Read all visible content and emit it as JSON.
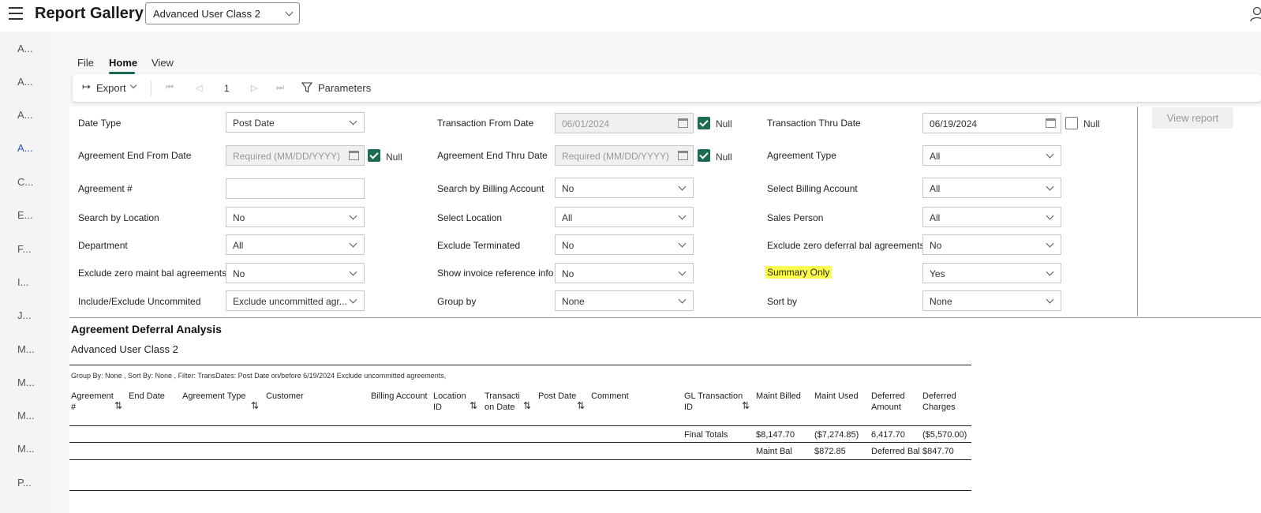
{
  "header": {
    "title": "Report Gallery",
    "class_select": "Advanced User Class 2"
  },
  "sidebar": {
    "items": [
      "A...",
      "A...",
      "A...",
      "A...",
      "C...",
      "E...",
      "F...",
      "I...",
      "J...",
      "M...",
      "M...",
      "M...",
      "M...",
      "P..."
    ],
    "active_index": 3
  },
  "tabs": [
    "File",
    "Home",
    "View"
  ],
  "toolbar": {
    "export_label": "Export",
    "page_number": "1",
    "parameters_label": "Parameters"
  },
  "params": {
    "date_type_label": "Date Type",
    "date_type_value": "Post Date",
    "trans_from_label": "Transaction From Date",
    "trans_from_value": "06/01/2024",
    "trans_thru_label": "Transaction Thru Date",
    "trans_thru_value": "06/19/2024",
    "agr_end_from_label": "Agreement End From Date",
    "agr_end_from_placeholder": "Required (MM/DD/YYYY)",
    "agr_end_thru_label": "Agreement End Thru Date",
    "agr_end_thru_placeholder": "Required (MM/DD/YYYY)",
    "agr_type_label": "Agreement Type",
    "agr_type_value": "All",
    "agr_num_label": "Agreement #",
    "agr_num_value": "",
    "search_billing_label": "Search by Billing Account",
    "search_billing_value": "No",
    "select_billing_label": "Select Billing Account",
    "select_billing_value": "All",
    "search_loc_label": "Search by Location",
    "search_loc_value": "No",
    "select_loc_label": "Select Location",
    "select_loc_value": "All",
    "sales_person_label": "Sales Person",
    "sales_person_value": "All",
    "department_label": "Department",
    "department_value": "All",
    "excl_term_label": "Exclude Terminated",
    "excl_term_value": "No",
    "excl_zero_def_label": "Exclude zero deferral bal agreements",
    "excl_zero_def_value": "No",
    "excl_zero_maint_label": "Exclude zero maint bal agreements",
    "excl_zero_maint_value": "No",
    "show_invoice_label": "Show invoice reference info",
    "show_invoice_value": "No",
    "summary_only_label": "Summary Only",
    "summary_only_value": "Yes",
    "incl_excl_label": "Include/Exclude Uncommited",
    "incl_excl_value": "Exclude uncommitted agr...",
    "group_by_label": "Group by",
    "group_by_value": "None",
    "sort_by_label": "Sort by",
    "sort_by_value": "None",
    "null_label": "Null",
    "view_report_label": "View report"
  },
  "report": {
    "title": "Agreement Deferral Analysis",
    "subtitle": "Advanced User Class 2",
    "filter_text": "Group By: None , Sort By: None , Filter: TransDates: Post Date on/before 6/19/2024 Exclude uncommitted agreements,",
    "columns": {
      "agreement": "Agreement #",
      "end_date": "End Date",
      "agreement_type": "Agreement Type",
      "customer": "Customer",
      "billing_account": "Billing Account",
      "location_id": "Location ID",
      "transaction_date": "Transacti on Date",
      "post_date": "Post Date",
      "comment": "Comment",
      "gl_transaction_id": "GL Transaction ID",
      "maint_billed": "Maint Billed",
      "maint_used": "Maint Used",
      "deferred_amount": "Deferred Amount",
      "deferred_charges": "Deferred Charges"
    },
    "totals": {
      "label": "Final Totals",
      "maint_billed": "$8,147.70",
      "maint_used": "($7,274.85)",
      "deferred_amount": "6,417.70",
      "deferred_charges": "($5,570.00)"
    },
    "balances": {
      "maint_bal_label": "Maint Bal",
      "maint_bal_value": "$872.85",
      "deferred_bal_label": "Deferred Bal",
      "deferred_bal_value": "$847.70"
    }
  }
}
